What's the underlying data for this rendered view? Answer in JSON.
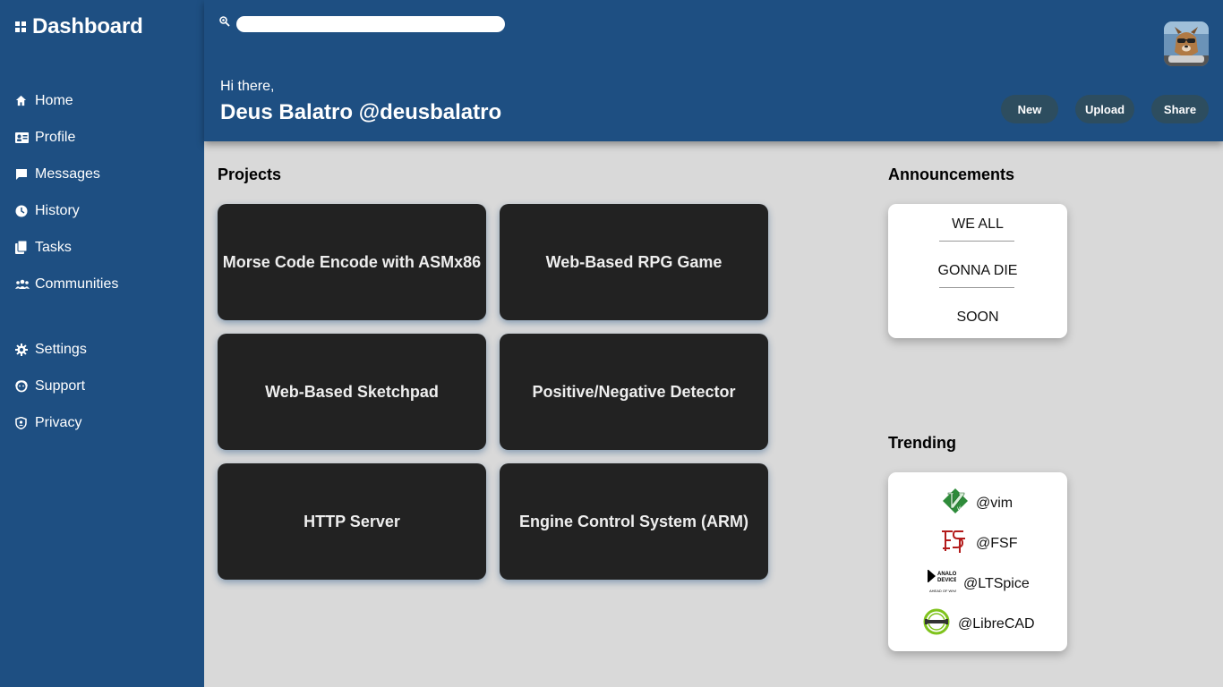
{
  "sidebar": {
    "title": "Dashboard",
    "nav_main": [
      {
        "label": "Home",
        "icon": "home-icon"
      },
      {
        "label": "Profile",
        "icon": "id-card-icon"
      },
      {
        "label": "Messages",
        "icon": "chat-icon"
      },
      {
        "label": "History",
        "icon": "clock-icon"
      },
      {
        "label": "Tasks",
        "icon": "copy-icon"
      },
      {
        "label": "Communities",
        "icon": "people-icon"
      }
    ],
    "nav_secondary": [
      {
        "label": "Settings",
        "icon": "gear-icon"
      },
      {
        "label": "Support",
        "icon": "support-icon"
      },
      {
        "label": "Privacy",
        "icon": "shield-icon"
      }
    ]
  },
  "header": {
    "search_placeholder": "",
    "greeting": "Hi there,",
    "user_name": "Deus Balatro @deusbalatro",
    "buttons": {
      "new": "New",
      "upload": "Upload",
      "share": "Share"
    }
  },
  "projects": {
    "title": "Projects",
    "items": [
      "Morse Code Encode with ASMx86",
      "Web-Based RPG Game",
      "Web-Based Sketchpad",
      "Positive/Negative Detector",
      "HTTP Server",
      "Engine Control System (ARM)"
    ]
  },
  "announcements": {
    "title": "Announcements",
    "lines": [
      "WE ALL",
      "GONNA DIE",
      "SOON"
    ]
  },
  "trending": {
    "title": "Trending",
    "items": [
      {
        "handle": "@vim",
        "icon": "vim-logo-icon"
      },
      {
        "handle": "@FSF",
        "icon": "fsf-logo-icon"
      },
      {
        "handle": "@LTSpice",
        "icon": "analog-devices-logo-icon"
      },
      {
        "handle": "@LibreCAD",
        "icon": "librecad-logo-icon"
      }
    ]
  },
  "colors": {
    "brand_blue": "#1e4f82",
    "card_dark": "#222222",
    "button_dark": "#2d4d5f",
    "background": "#d9d9d9"
  }
}
